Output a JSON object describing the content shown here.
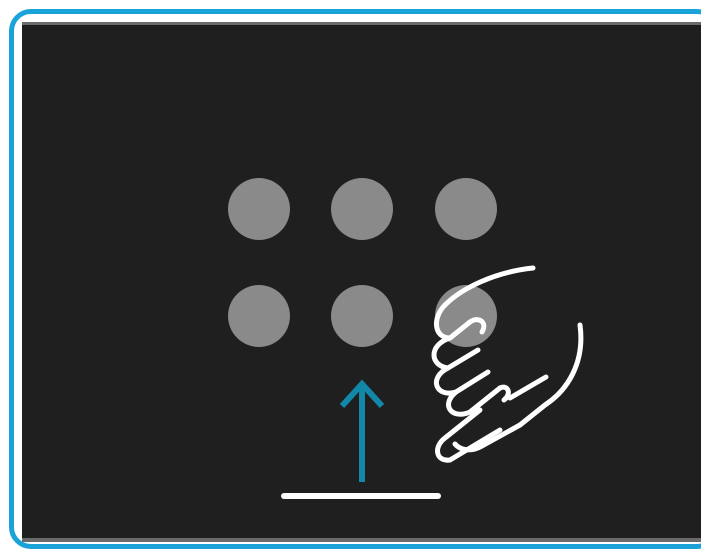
{
  "illustration": {
    "type": "gesture-instruction",
    "gesture": "swipe-up-from-bottom",
    "app_icon_count": 6,
    "colors": {
      "frame_border": "#1aa3d9",
      "screen_background": "#1f1f1f",
      "app_icon": "#8a8a8a",
      "arrow": "#1287a8",
      "home_indicator": "#ffffff",
      "hand_outline": "#ffffff"
    },
    "icons": [
      "app-icon",
      "up-arrow-icon",
      "home-indicator",
      "hand-pointer-icon"
    ]
  }
}
